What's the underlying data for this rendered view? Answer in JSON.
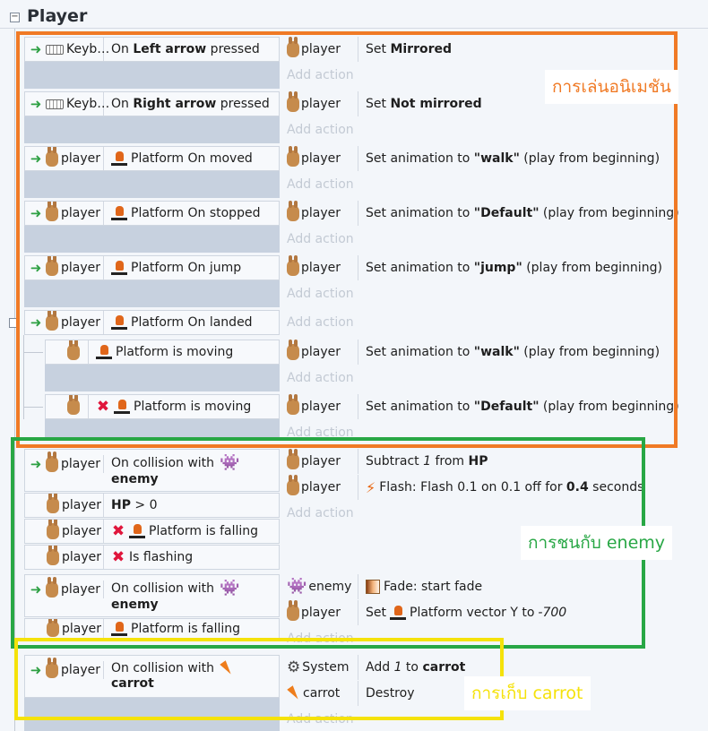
{
  "group": {
    "title": "Player",
    "toggle": "−"
  },
  "labels": {
    "keyboard": "Keyb…",
    "player": "player",
    "enemy": "enemy",
    "system": "System",
    "carrot": "carrot",
    "add_action": "Add action"
  },
  "events": {
    "e1": {
      "cond": [
        "On ",
        "Left arrow",
        " pressed"
      ],
      "act": [
        "Set ",
        "Mirrored"
      ]
    },
    "e2": {
      "cond": [
        "On ",
        "Right arrow",
        " pressed"
      ],
      "act": [
        "Set ",
        "Not mirrored"
      ]
    },
    "e3": {
      "cond": "Platform On moved",
      "act": [
        "Set animation to ",
        "\"walk\"",
        " (play from beginning)"
      ]
    },
    "e4": {
      "cond": "Platform On stopped",
      "act": [
        "Set animation to ",
        "\"Default\"",
        " (play from beginning)"
      ]
    },
    "e5": {
      "cond": "Platform On jump",
      "act": [
        "Set animation to ",
        "\"jump\"",
        " (play from beginning)"
      ]
    },
    "e6": {
      "cond": "Platform On landed"
    },
    "e6a": {
      "cond": "Platform is moving",
      "act": [
        "Set animation to ",
        "\"walk\"",
        " (play from beginning)"
      ]
    },
    "e6b": {
      "cond": "Platform is moving",
      "act": [
        "Set animation to ",
        "\"Default\"",
        " (play from beginning)"
      ]
    },
    "e7": {
      "cond1": [
        "On collision with",
        "enemy"
      ],
      "cond2": [
        "HP",
        " > 0"
      ],
      "cond3": "Platform is falling",
      "cond4": "Is flashing",
      "act1": [
        "Subtract ",
        "1",
        " from ",
        "HP"
      ],
      "act2": [
        "Flash: Flash 0.1 on 0.1 off for ",
        "0.4",
        " seconds"
      ]
    },
    "e8": {
      "cond1": [
        "On collision with",
        "enemy"
      ],
      "cond2": "Platform is falling",
      "act1": "Fade: start fade",
      "act2": [
        "Set ",
        "Platform vector Y to ",
        "-700"
      ]
    },
    "e9": {
      "cond1": [
        "On collision with",
        "carrot"
      ],
      "act1": [
        "Add ",
        "1",
        " to ",
        "carrot"
      ],
      "act2": "Destroy"
    }
  },
  "annotations": {
    "animation": {
      "text": "การเล่นอนิเมชัน",
      "color": "#f07a25"
    },
    "enemy": {
      "text": "การชนกับ enemy",
      "color": "#28a745"
    },
    "carrot": {
      "text": "การเก็บ carrot",
      "color": "#f5e20a"
    }
  }
}
